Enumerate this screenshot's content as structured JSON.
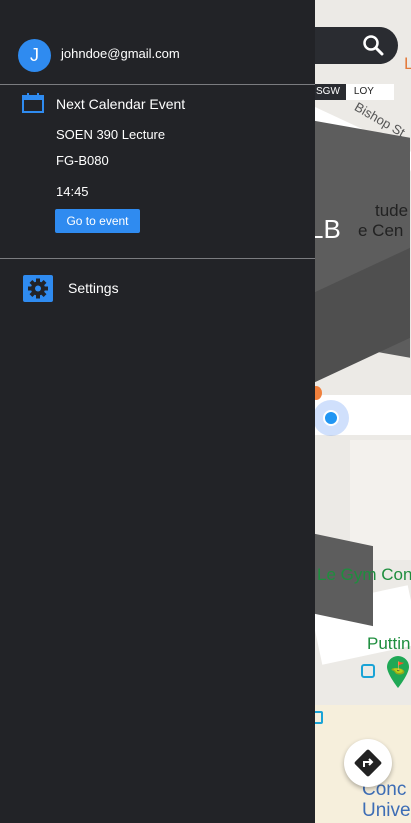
{
  "map": {
    "campus_toggle": {
      "sgw_label": "SGW",
      "loy_label": "LOY"
    },
    "labels": {
      "bishop_st": "Bishop St",
      "building_code": "LB",
      "library_name_1": "tude",
      "library_name_2": "e Cen",
      "gym_name": "Le Gym Con",
      "putting_name": "Puttin",
      "university_1": "Conc",
      "university_2": "Unive",
      "top_right_letter": "L"
    },
    "colors": {
      "location_dot": "#2196f3",
      "gym_text": "#1e8e3e",
      "university_text": "#3d6db5"
    }
  },
  "drawer": {
    "user": {
      "avatar_initial": "J",
      "email": "johndoe@gmail.com"
    },
    "calendar": {
      "title": "Next Calendar Event",
      "event_name": "SOEN 390 Lecture",
      "event_room": "FG-B080",
      "event_time": "14:45",
      "go_button_label": "Go to event"
    },
    "settings": {
      "label": "Settings"
    },
    "colors": {
      "background": "#222327",
      "accent": "#2f8bf0"
    }
  }
}
